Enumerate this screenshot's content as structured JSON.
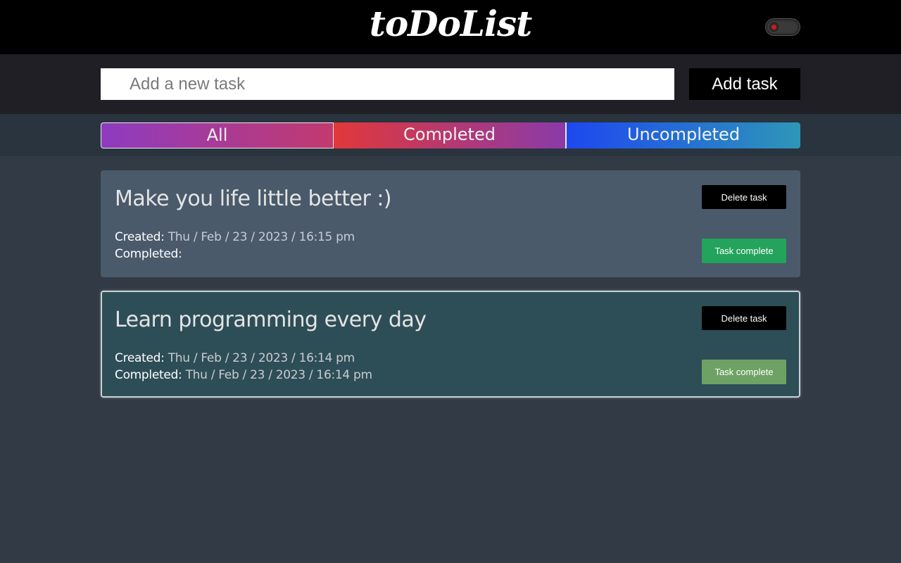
{
  "header": {
    "logo": "toDoList",
    "theme_toggle": {
      "state": "on",
      "indicator_color": "#d11a1a"
    }
  },
  "add_task": {
    "placeholder": "Add a new task",
    "value": "",
    "button_label": "Add task"
  },
  "filters": [
    {
      "label": "All",
      "active": true
    },
    {
      "label": "Completed",
      "active": false
    },
    {
      "label": "Uncompleted",
      "active": false
    }
  ],
  "tasks": [
    {
      "title": "Make you life little better :)",
      "created_label": "Created:",
      "created_value": "Thu / Feb / 23 / 2023 / 16:15 pm",
      "completed_label": "Completed:",
      "completed_value": "",
      "delete_label": "Delete task",
      "complete_label": "Task complete",
      "status": "uncompleted"
    },
    {
      "title": "Learn programming every day",
      "created_label": "Created:",
      "created_value": "Thu / Feb / 23 / 2023 / 16:14 pm",
      "completed_label": "Completed:",
      "completed_value": "Thu / Feb / 23 / 2023 / 16:14 pm",
      "delete_label": "Delete task",
      "complete_label": "Task complete",
      "status": "completed"
    }
  ],
  "colors": {
    "page_bg": "#323a45",
    "header_bg": "#000000",
    "uncompleted_card": "#4a5a6b",
    "completed_card": "#2e4e57",
    "complete_button": "#23a35b",
    "complete_button_done": "#6ea264"
  }
}
